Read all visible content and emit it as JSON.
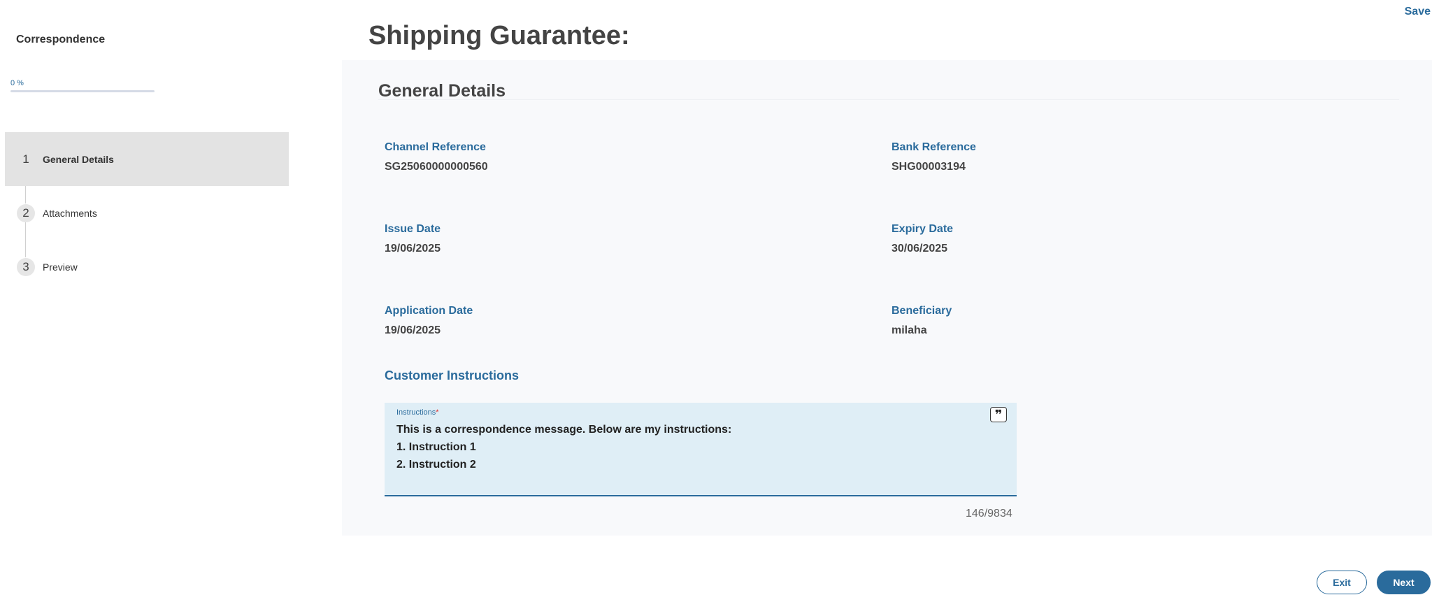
{
  "sidebar": {
    "title": "Correspondence",
    "progress_text": "0 %",
    "progress_fraction": 0,
    "steps": [
      {
        "number": "1",
        "label": "General Details",
        "active": true
      },
      {
        "number": "2",
        "label": "Attachments",
        "active": false
      },
      {
        "number": "3",
        "label": "Preview",
        "active": false
      }
    ]
  },
  "header": {
    "title": "Shipping Guarantee:",
    "save_label": "Save"
  },
  "main": {
    "section_title": "General Details",
    "fields": {
      "channel_reference": {
        "label": "Channel Reference",
        "value": "SG25060000000560"
      },
      "bank_reference": {
        "label": "Bank Reference",
        "value": "SHG00003194"
      },
      "issue_date": {
        "label": "Issue Date",
        "value": "19/06/2025"
      },
      "expiry_date": {
        "label": "Expiry Date",
        "value": "30/06/2025"
      },
      "application_date": {
        "label": "Application Date",
        "value": "19/06/2025"
      },
      "beneficiary": {
        "label": "Beneficiary",
        "value": "milaha"
      }
    },
    "customer_instructions": {
      "title": "Customer Instructions",
      "field_label": "Instructions",
      "required_mark": "*",
      "lines": [
        "This is a correspondence message. Below are my instructions:",
        "1. Instruction 1",
        "2. Instruction 2"
      ],
      "char_count": "146/9834",
      "quote_icon": "quote-icon"
    }
  },
  "footer": {
    "exit_label": "Exit",
    "next_label": "Next"
  },
  "colors": {
    "accent": "#2a6b9c",
    "panel_bg": "#f8f9fb",
    "input_bg": "#dfeef6",
    "active_step_bg": "#e3e3e3"
  }
}
